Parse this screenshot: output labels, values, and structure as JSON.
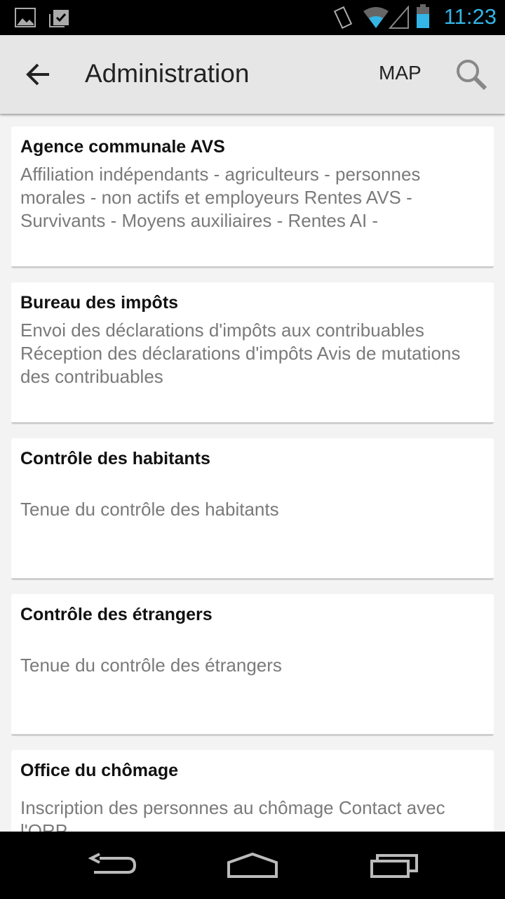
{
  "status_bar": {
    "time": "11:23",
    "icons": [
      "image-icon",
      "clipboard-check-icon",
      "vibrate-icon",
      "wifi-icon",
      "signal-icon",
      "battery-icon"
    ],
    "accent": "#33b5e5"
  },
  "action_bar": {
    "title": "Administration",
    "map_label": "MAP",
    "icons": [
      "back-arrow-icon",
      "search-icon"
    ]
  },
  "items": [
    {
      "title": "Agence communale AVS",
      "description": "Affiliation indépendants - agriculteurs - personnes morales - non actifs et employeurs  Rentes AVS - Survivants - Moyens auxiliaires -  Rentes AI -"
    },
    {
      "title": "Bureau des impôts",
      "description": "Envoi des déclarations d'impôts aux contribuables Réception des déclarations d'impôts Avis de mutations des contribuables"
    },
    {
      "title": "Contrôle des habitants",
      "description": "Tenue du contrôle des habitants"
    },
    {
      "title": "Contrôle des étrangers",
      "description": "Tenue du contrôle des étrangers"
    },
    {
      "title": "Office du chômage",
      "description": "Inscription des personnes au chômage Contact avec l'ORP"
    }
  ],
  "nav_bar": {
    "icons": [
      "back-icon",
      "home-icon",
      "recents-icon"
    ]
  }
}
